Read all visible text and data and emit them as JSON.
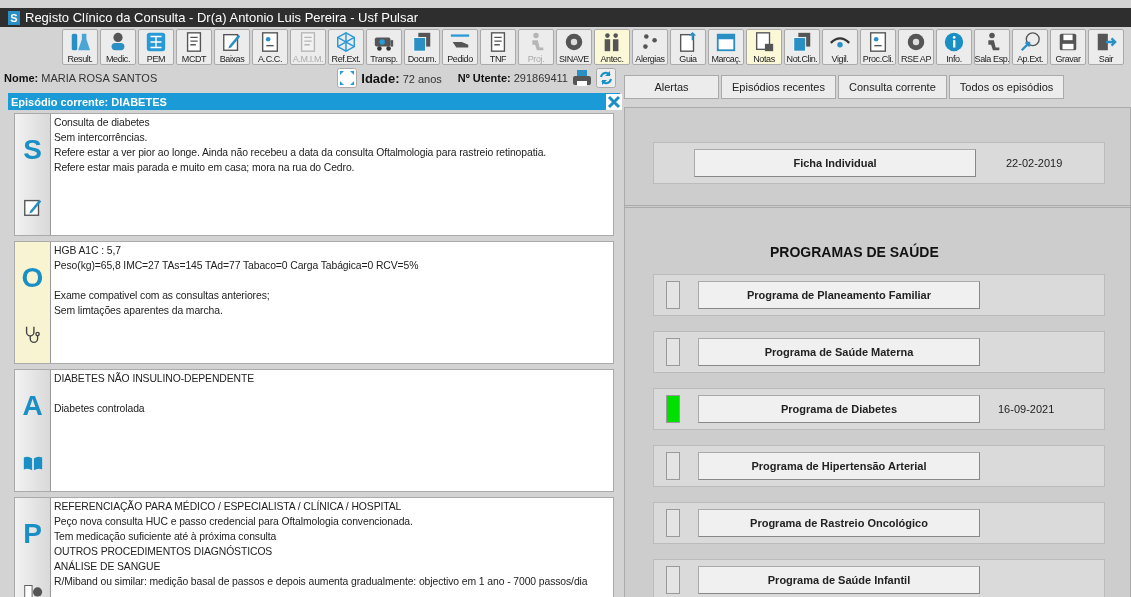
{
  "window": {
    "app_logo": "S",
    "title": "Registo Clínico da Consulta - Dr(a) Antonio Luis Pereira - Usf Pulsar"
  },
  "toolbar": [
    {
      "label": "Result.",
      "disabled": false,
      "highlighted": false
    },
    {
      "label": "Medic.",
      "disabled": false,
      "highlighted": false
    },
    {
      "label": "PEM",
      "disabled": false,
      "highlighted": false
    },
    {
      "label": "MCDT",
      "disabled": false,
      "highlighted": false
    },
    {
      "label": "Baixas",
      "disabled": false,
      "highlighted": false
    },
    {
      "label": "A.C.C.",
      "disabled": false,
      "highlighted": false
    },
    {
      "label": "A.M.I.M.",
      "disabled": true,
      "highlighted": false
    },
    {
      "label": "Ref.Ext.",
      "disabled": false,
      "highlighted": false
    },
    {
      "label": "Transp.",
      "disabled": false,
      "highlighted": false
    },
    {
      "label": "Docum.",
      "disabled": false,
      "highlighted": false
    },
    {
      "label": "Pedido",
      "disabled": false,
      "highlighted": false
    },
    {
      "label": "TNF",
      "disabled": false,
      "highlighted": false
    },
    {
      "label": "Proj.",
      "disabled": true,
      "highlighted": false
    },
    {
      "label": "SINAVE",
      "disabled": false,
      "highlighted": false
    },
    {
      "label": "Antec.",
      "disabled": false,
      "highlighted": true
    },
    {
      "label": "Alergias",
      "disabled": false,
      "highlighted": false
    },
    {
      "label": "Guia",
      "disabled": false,
      "highlighted": false
    },
    {
      "label": "Marcaç.",
      "disabled": false,
      "highlighted": false
    },
    {
      "label": "Notas",
      "disabled": false,
      "highlighted": true
    },
    {
      "label": "Not.Clin.",
      "disabled": false,
      "highlighted": false
    },
    {
      "label": "Vigil.",
      "disabled": false,
      "highlighted": false
    },
    {
      "label": "Proc.Cli.",
      "disabled": false,
      "highlighted": false
    },
    {
      "label": "RSE AP",
      "disabled": false,
      "highlighted": false
    },
    {
      "label": "Info.",
      "disabled": false,
      "highlighted": false
    },
    {
      "label": "Sala Esp.",
      "disabled": false,
      "highlighted": false
    },
    {
      "label": "Ap.Ext.",
      "disabled": false,
      "highlighted": false
    },
    {
      "label": "Gravar",
      "disabled": false,
      "highlighted": false
    },
    {
      "label": "Sair",
      "disabled": false,
      "highlighted": false
    }
  ],
  "patient": {
    "name_label": "Nome:",
    "name": "MARIA ROSA SANTOS",
    "age_label": "Idade:",
    "age": "72 anos",
    "number_label": "Nº Utente:",
    "number": "291869411"
  },
  "tabs": [
    {
      "label": "Alertas"
    },
    {
      "label": "Episódios recentes"
    },
    {
      "label": "Consulta corrente"
    },
    {
      "label": "Todos os episódios"
    }
  ],
  "episode": {
    "title": "Episódio corrente: DIABETES"
  },
  "soap": [
    {
      "letter": "S",
      "highlighted": false,
      "paragraphs": [
        [
          "Consulta de diabetes",
          "Sem intercorrências.",
          "Refere estar a ver pior ao longe. Ainda não recebeu a data da consulta Oftalmologia para rastreio retinopatia.",
          "Refere estar mais parada e muito em casa; mora na rua do Cedro."
        ]
      ]
    },
    {
      "letter": "O",
      "highlighted": true,
      "paragraphs": [
        [
          "HGB A1C : 5,7",
          "Peso(kg)=65,8 IMC=27 TAs=145 TAd=77 Tabaco=0 Carga Tabágica=0 RCV=5%"
        ],
        [
          "Exame compativel com as consultas anteriores;",
          "Sem limtações aparentes da marcha."
        ]
      ]
    },
    {
      "letter": "A",
      "highlighted": false,
      "paragraphs": [
        [
          "DIABETES NÃO INSULINO-DEPENDENTE"
        ],
        [
          "Diabetes controlada"
        ]
      ]
    },
    {
      "letter": "P",
      "highlighted": false,
      "paragraphs": [
        [
          "REFERENCIAÇÃO PARA MÉDICO / ESPECIALISTA / CLÍNICA / HOSPITAL",
          "Peço nova consulta HUC e passo credencial para Oftalmologia convencionada.",
          "Tem medicação suficiente até à próxima consulta",
          "OUTROS PROCEDIMENTOS DIAGNÓSTICOS",
          "ANÁLISE DE SANGUE",
          "R/Miband ou similar: medição basal de passos e depois aumenta gradualmente: objectivo em 1 ano - 7000 passos/dia"
        ]
      ]
    }
  ],
  "ficha": {
    "label": "Ficha Individual",
    "date": "22-02-2019"
  },
  "programs_title": "PROGRAMAS DE SAÚDE",
  "programs": [
    {
      "label": "Programa de Planeamento Familiar",
      "active": false
    },
    {
      "label": "Programa de Saúde Materna",
      "active": false
    },
    {
      "label": "Programa de Diabetes",
      "active": true,
      "date": "16-09-2021"
    },
    {
      "label": "Programa de Hipertensão Arterial",
      "active": false
    },
    {
      "label": "Programa de Rastreio Oncológico",
      "active": false
    },
    {
      "label": "Programa de Saúde Infantil",
      "active": false
    }
  ]
}
